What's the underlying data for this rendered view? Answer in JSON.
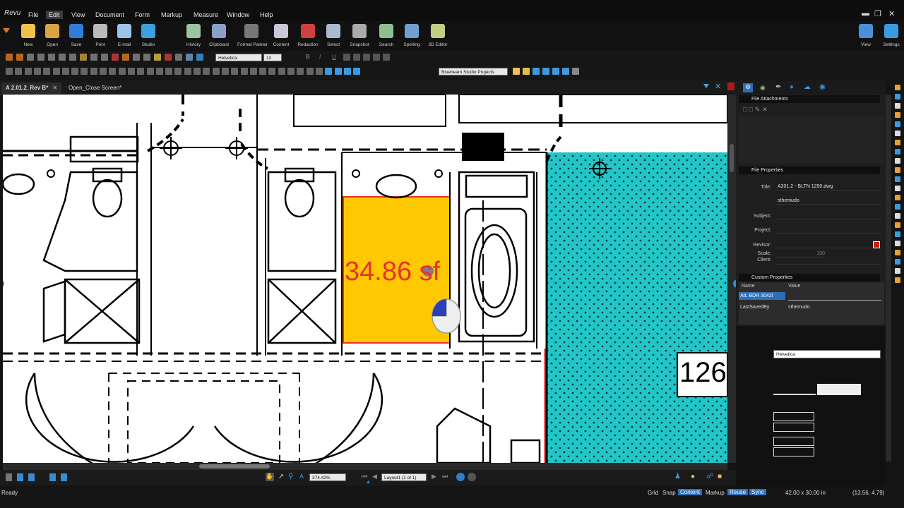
{
  "app": {
    "logo": "Revu"
  },
  "menu": [
    "File",
    "Edit",
    "View",
    "Document",
    "Form",
    "Markup",
    "Measure",
    "Window",
    "Help"
  ],
  "menu_active": "Edit",
  "ribbon": {
    "left": [
      {
        "label": "New",
        "icon": "new-file-icon",
        "color": "#f2c14e"
      },
      {
        "label": "Open",
        "icon": "open-folder-icon",
        "color": "#d9a441"
      },
      {
        "label": "Save",
        "icon": "save-icon",
        "color": "#2f7fd8"
      },
      {
        "label": "Print",
        "icon": "print-icon",
        "color": "#bbbbbb"
      },
      {
        "label": "E-mail",
        "icon": "email-icon",
        "color": "#9ec3e8"
      },
      {
        "label": "Studio",
        "icon": "studio-icon",
        "color": "#3aa0e0"
      }
    ],
    "middle": [
      {
        "label": "History",
        "icon": "history-icon",
        "color": "#9bc4a0"
      },
      {
        "label": "Clipboard",
        "icon": "clipboard-icon",
        "color": "#8aa0c8"
      },
      {
        "label": "Format Painter",
        "icon": "format-painter-icon",
        "color": "#777777"
      },
      {
        "label": "Content",
        "icon": "content-icon",
        "color": "#c8c8d8"
      },
      {
        "label": "Redaction",
        "icon": "redaction-icon",
        "color": "#d04040"
      },
      {
        "label": "Select",
        "icon": "select-icon",
        "color": "#aabbd0"
      },
      {
        "label": "Snapshot",
        "icon": "snapshot-icon",
        "color": "#aaaaaa"
      },
      {
        "label": "Search",
        "icon": "search-binoculars-icon",
        "color": "#8fbf8f"
      },
      {
        "label": "Spelling",
        "icon": "spelling-icon",
        "color": "#6fa0d0"
      },
      {
        "label": "3D Editor",
        "icon": "3d-editor-icon",
        "color": "#c0d080"
      }
    ],
    "right": [
      {
        "label": "View",
        "icon": "view-monitor-icon",
        "color": "#4a90d9"
      },
      {
        "label": "Settings",
        "icon": "settings-icon",
        "color": "#3a9ae0"
      }
    ]
  },
  "font_combo": {
    "font": "Helvetica",
    "size": "12"
  },
  "studio_combo": "Bluebeam Studio Projects",
  "tabs": [
    {
      "label": "A 2.01.2_Rev B*",
      "active": true
    },
    {
      "label": "Open_Close Screen*",
      "active": false
    }
  ],
  "drawing": {
    "area_measure": "34.86 sf",
    "room_tag": "126",
    "colors": {
      "hatch": "#22c6c8",
      "area_fill": "#ffc800",
      "measure_text": "#e8302a",
      "area_border": "#e8302a"
    }
  },
  "navbar": {
    "zoom": "374.42%",
    "page": "Layout1 (1 of 1)"
  },
  "status": {
    "left": "Ready",
    "toggles": [
      "Grid",
      "Snap",
      "Content",
      "Markup",
      "Reuse",
      "Sync"
    ],
    "active_toggles": [
      "Content",
      "Reuse"
    ],
    "dimensions": "42.00 x 30.00 in",
    "coords": "(13.56, 4.79)"
  },
  "panel": {
    "file_attachments": "File Attachments",
    "file_properties": "File Properties",
    "props": [
      {
        "label": "Title:",
        "value": "A201.2 - BLTN 1250.dwg"
      },
      {
        "label": "",
        "value": "sthemudo"
      },
      {
        "label": "Subject:",
        "value": ""
      },
      {
        "label": "Project:",
        "value": ""
      },
      {
        "label": "Revisor:",
        "value": ""
      },
      {
        "label": "Scale:",
        "value": "100"
      },
      {
        "label": "Client:",
        "value": ""
      }
    ],
    "custom_properties": "Custom Properties",
    "custom_headers": {
      "name": "Name",
      "value": "Value"
    },
    "custom_rows": [
      {
        "name": "Att. BDR 3042l",
        "value": ""
      },
      {
        "name": "LastSavedBy",
        "value": "sthemudo"
      }
    ],
    "font_select": "Helvetica"
  }
}
